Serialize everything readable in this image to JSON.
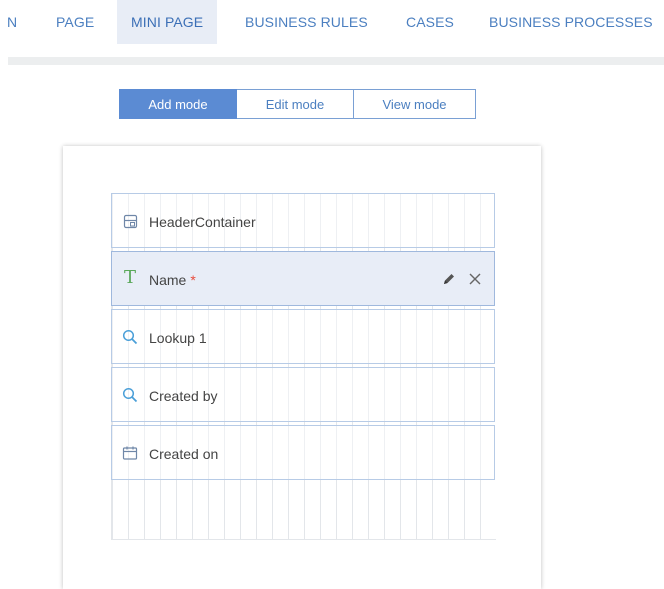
{
  "tabs": [
    {
      "label": "N"
    },
    {
      "label": "PAGE"
    },
    {
      "label": "MINI PAGE"
    },
    {
      "label": "BUSINESS RULES"
    },
    {
      "label": "CASES"
    },
    {
      "label": "BUSINESS PROCESSES"
    }
  ],
  "active_tab": "MINI PAGE",
  "modes": {
    "add": "Add mode",
    "edit": "Edit mode",
    "view": "View mode",
    "active": "Add mode"
  },
  "rows": [
    {
      "label": "HeaderContainer",
      "icon": "container-icon"
    },
    {
      "label": "Name",
      "icon": "text-field-icon",
      "required_mark": "*",
      "selected": true
    },
    {
      "label": "Lookup 1",
      "icon": "lookup-search-icon"
    },
    {
      "label": "Created by",
      "icon": "lookup-search-icon"
    },
    {
      "label": "Created on",
      "icon": "calendar-icon"
    }
  ],
  "icons": {
    "edit": "pencil-icon",
    "remove": "close-icon"
  },
  "colors": {
    "accent": "#4b7fc0",
    "mode_active_bg": "#5b8bd3",
    "selected_row_bg": "#e8edf7",
    "required": "#e84b3c",
    "text_icon": "#5aa85a"
  }
}
